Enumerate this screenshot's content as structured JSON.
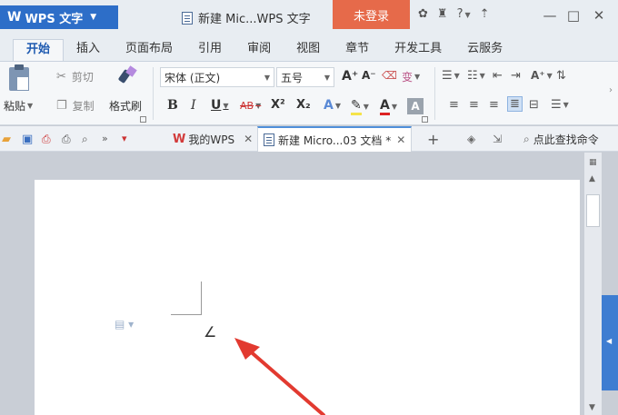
{
  "titlebar": {
    "app_name": "WPS 文字",
    "doc_title": "新建 Mic...WPS 文字",
    "login": "未登录",
    "help": "?",
    "minimize": "—",
    "maximize": "□",
    "close": "✕"
  },
  "menu": {
    "tabs": [
      "开始",
      "插入",
      "页面布局",
      "引用",
      "审阅",
      "视图",
      "章节",
      "开发工具",
      "云服务"
    ],
    "active": "开始"
  },
  "ribbon": {
    "paste": "粘贴",
    "cut": "剪切",
    "copy": "复制",
    "format_painter": "格式刷",
    "font_name": "宋体 (正文)",
    "font_size": "五号",
    "bold": "B",
    "italic": "I",
    "underline": "U",
    "strike": "AB",
    "superscript": "X²",
    "subscript": "X₂",
    "font_color": "A",
    "grow_font": "A⁺",
    "shrink_font": "A⁻",
    "phonetic": "变"
  },
  "qbar": {
    "tab_home": "我的WPS",
    "tab_doc": "新建 Micro...03 文档 *",
    "add_tab": "+",
    "find": "点此查找命令"
  },
  "colors": {
    "accent": "#2d6ec8",
    "login_bg": "#e66a4a",
    "side_tab": "#3e7dd1"
  }
}
